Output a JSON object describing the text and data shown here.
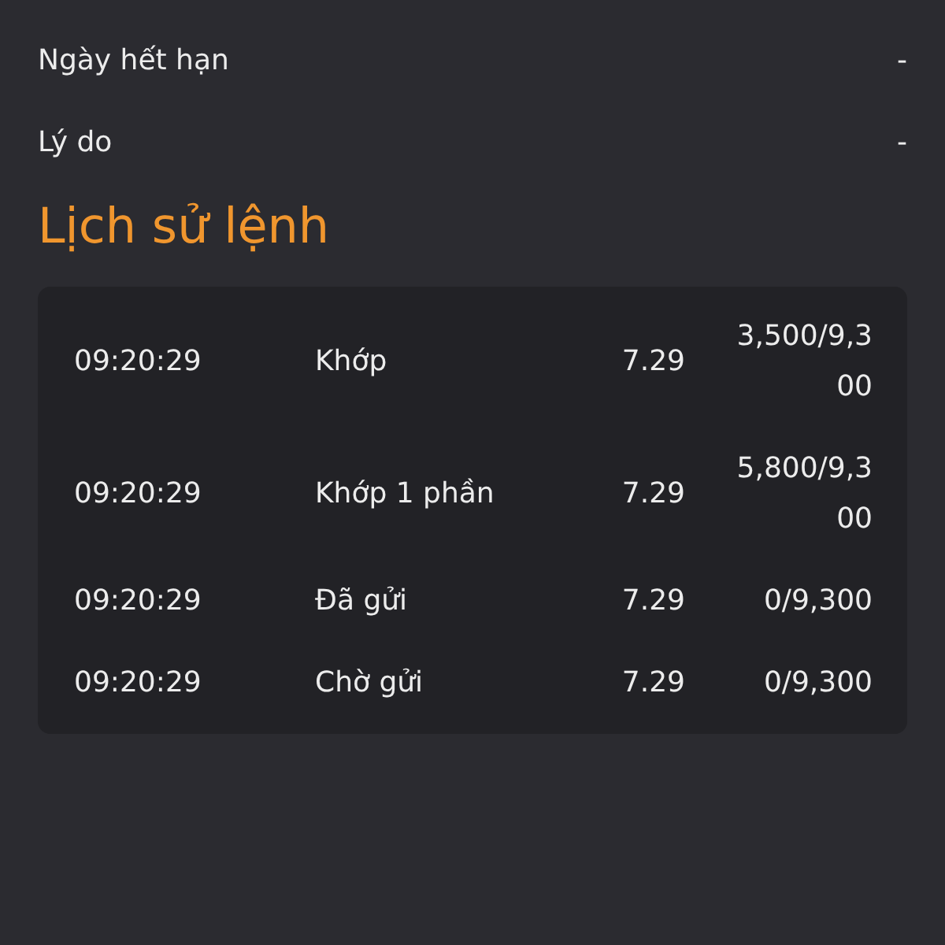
{
  "details": [
    {
      "label": "Ngày hết hạn",
      "value": "-"
    },
    {
      "label": "Lý do",
      "value": "-"
    }
  ],
  "history": {
    "title": "Lịch sử lệnh",
    "rows": [
      {
        "time": "09:20:29",
        "status": "Khớp",
        "price": "7.29",
        "quantity": "3,500/9,300"
      },
      {
        "time": "09:20:29",
        "status": "Khớp 1 phần",
        "price": "7.29",
        "quantity": "5,800/9,300"
      },
      {
        "time": "09:20:29",
        "status": "Đã gửi",
        "price": "7.29",
        "quantity": "0/9,300"
      },
      {
        "time": "09:20:29",
        "status": "Chờ gửi",
        "price": "7.29",
        "quantity": "0/9,300"
      }
    ]
  }
}
